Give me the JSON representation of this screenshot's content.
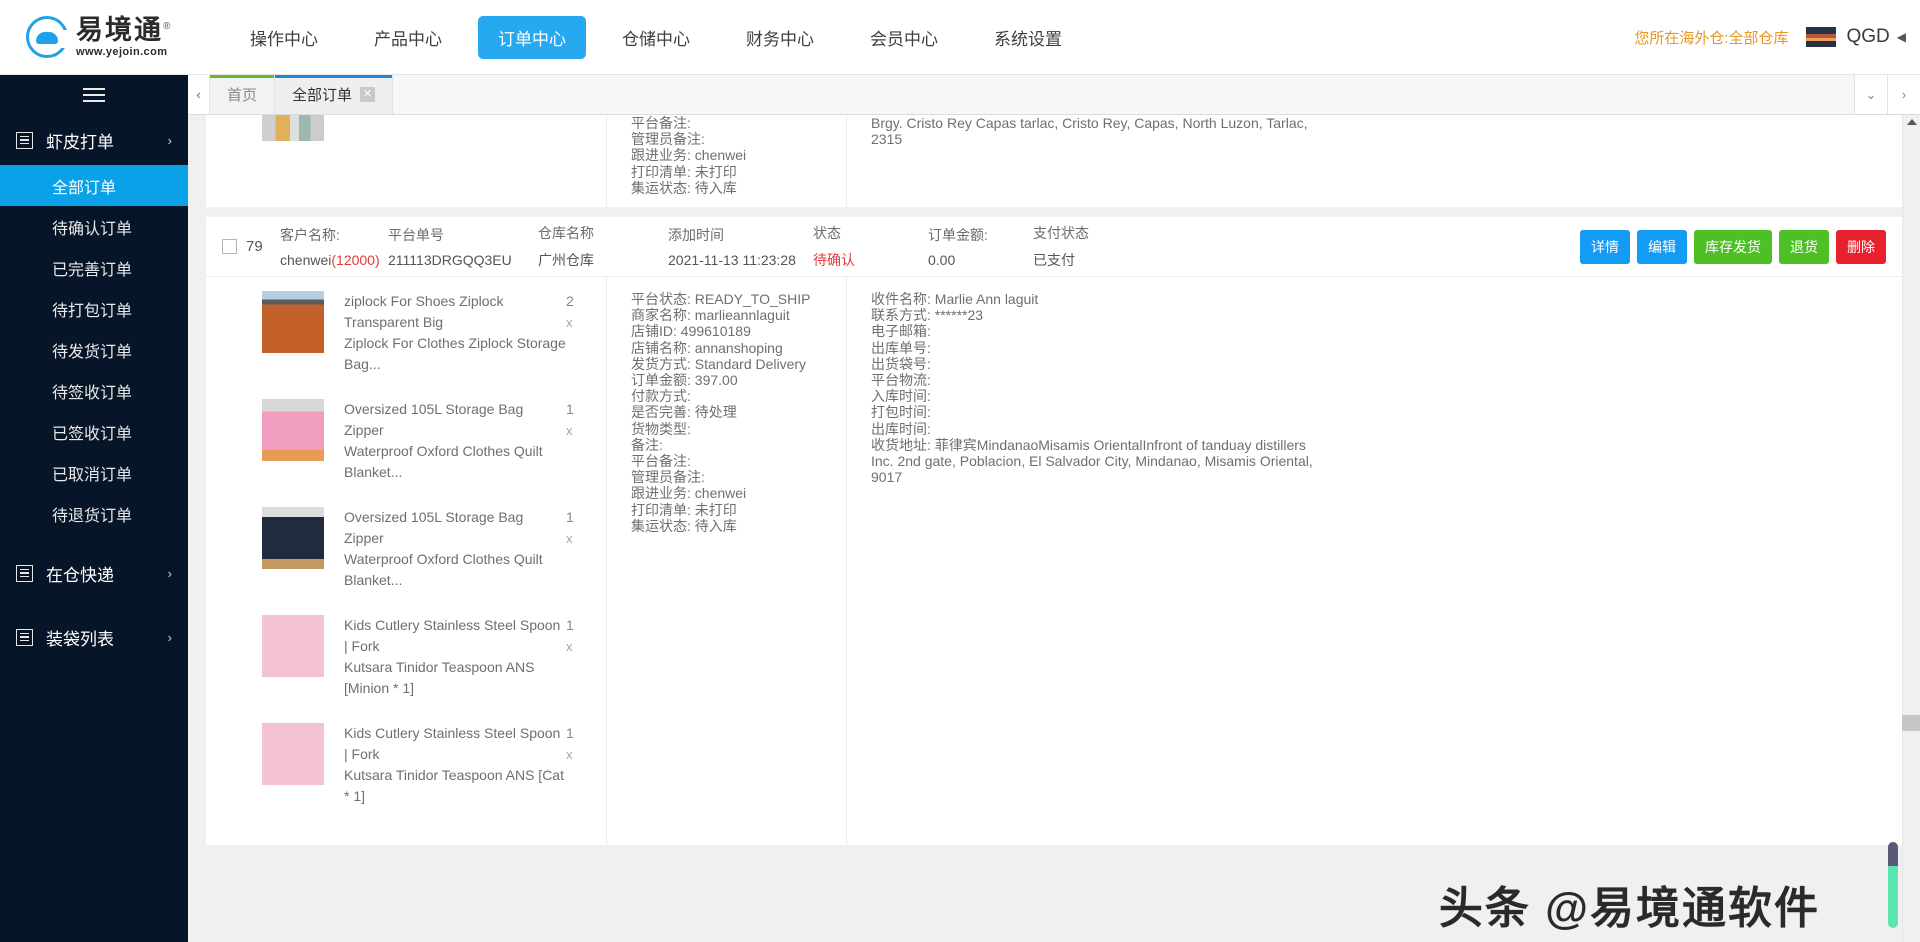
{
  "header": {
    "logo": {
      "cn": "易境通",
      "registered": "®",
      "url": "www.yejoin.com"
    },
    "nav": [
      {
        "label": "操作中心",
        "active": false
      },
      {
        "label": "产品中心",
        "active": false
      },
      {
        "label": "订单中心",
        "active": true
      },
      {
        "label": "仓储中心",
        "active": false
      },
      {
        "label": "财务中心",
        "active": false
      },
      {
        "label": "会员中心",
        "active": false
      },
      {
        "label": "系统设置",
        "active": false
      }
    ],
    "warehouse_note": "您所在海外仓:全部仓库",
    "user_name": "QGD",
    "caret": "◀",
    "accent_color": "#26a9f0",
    "note_color": "#e8961f"
  },
  "sidebar": {
    "toggle_icon": "hamburger-icon",
    "groups": [
      {
        "label": "虾皮打单",
        "arrow": "›",
        "items": [
          {
            "label": "全部订单",
            "active": true
          },
          {
            "label": "待确认订单",
            "active": false
          },
          {
            "label": "已完善订单",
            "active": false
          },
          {
            "label": "待打包订单",
            "active": false
          },
          {
            "label": "待发货订单",
            "active": false
          },
          {
            "label": "待签收订单",
            "active": false
          },
          {
            "label": "已签收订单",
            "active": false
          },
          {
            "label": "已取消订单",
            "active": false
          },
          {
            "label": "待退货订单",
            "active": false
          }
        ]
      },
      {
        "label": "在仓快递",
        "arrow": "›",
        "items": []
      },
      {
        "label": "装袋列表",
        "arrow": "›",
        "items": []
      }
    ],
    "active_color": "#0aa1e8",
    "bg_color": "#061528"
  },
  "tabstrip": {
    "prev_arrow": "‹",
    "tabs": [
      {
        "label": "首页",
        "active": false,
        "closable": false,
        "accent": "#68b92e"
      },
      {
        "label": "全部订单",
        "active": true,
        "closable": true,
        "close_icon": "close-icon",
        "close_glyph": "✕",
        "accent": "#1e86e0"
      }
    ],
    "controls": [
      {
        "icon": "chevron-down-icon",
        "glyph": "⌄"
      },
      {
        "icon": "chevron-right-icon",
        "glyph": "›"
      }
    ]
  },
  "partial_order": {
    "mid_fields": [
      {
        "key": "平台备注:",
        "value": ""
      },
      {
        "key": "管理员备注:",
        "value": ""
      },
      {
        "key": "跟进业务:",
        "value": "chenwei"
      },
      {
        "key": "打印清单:",
        "value": "未打印"
      },
      {
        "key": "集运状态:",
        "value": "待入库"
      }
    ],
    "address": "Brgy. Cristo Rey Capas tarlac, Cristo Rey, Capas, North Luzon, Tarlac, 2315"
  },
  "order": {
    "checkbox_checked": false,
    "seq": "79",
    "head_columns": [
      {
        "label": "客户名称:",
        "value": "chenwei",
        "paren": "(12000)",
        "red_paren": true
      },
      {
        "label": "平台单号",
        "value": "211113DRGQQ3EU"
      },
      {
        "label": "仓库名称",
        "value": "广州仓库"
      },
      {
        "label": "添加时间",
        "value": "2021-11-13 11:23:28"
      },
      {
        "label": "状态",
        "value": "待确认",
        "red": true
      },
      {
        "label": "订单金额:",
        "value": "0.00"
      },
      {
        "label": "支付状态",
        "value": "已支付"
      }
    ],
    "actions": [
      {
        "label": "详情",
        "color": "blue"
      },
      {
        "label": "编辑",
        "color": "blue"
      },
      {
        "label": "库存发货",
        "color": "green"
      },
      {
        "label": "退货",
        "color": "green"
      },
      {
        "label": "删除",
        "color": "red"
      }
    ],
    "products": [
      {
        "line1": "ziplock For Shoes Ziplock Transparent Big",
        "line2": "Ziplock For Clothes Ziplock Storage Bag...",
        "qty": "2",
        "x": "x",
        "thumb": "orange-jacket-thumb"
      },
      {
        "line1": "Oversized 105L Storage Bag Zipper",
        "line2": "Waterproof Oxford Clothes Quilt Blanket...",
        "qty": "1",
        "x": "x",
        "thumb": "pink-storage-bag-thumb"
      },
      {
        "line1": "Oversized 105L Storage Bag Zipper",
        "line2": "Waterproof Oxford Clothes Quilt Blanket...",
        "qty": "1",
        "x": "x",
        "thumb": "navy-storage-bag-thumb"
      },
      {
        "line1": "Kids Cutlery Stainless Steel Spoon | Fork",
        "line2": "Kutsara Tinidor Teaspoon ANS [Minion * 1]",
        "qty": "1",
        "x": "x",
        "thumb": "minion-spoon-thumb"
      },
      {
        "line1": "Kids Cutlery Stainless Steel Spoon | Fork",
        "line2": "Kutsara Tinidor Teaspoon ANS [Cat * 1]",
        "qty": "1",
        "x": "x",
        "thumb": "cat-spoon-thumb"
      }
    ],
    "mid_fields": [
      {
        "key": "平台状态:",
        "value": "READY_TO_SHIP"
      },
      {
        "key": "商家名称:",
        "value": "marlieannlaguit"
      },
      {
        "key": "店铺ID:",
        "value": "499610189"
      },
      {
        "key": "店铺名称:",
        "value": "annanshoping"
      },
      {
        "key": "发货方式:",
        "value": "Standard Delivery"
      },
      {
        "key": "订单金额:",
        "value": "397.00"
      },
      {
        "key": "付款方式:",
        "value": ""
      },
      {
        "key": "是否完善:",
        "value": "待处理"
      },
      {
        "key": "货物类型:",
        "value": ""
      },
      {
        "key": "备注:",
        "value": ""
      },
      {
        "key": "平台备注:",
        "value": ""
      },
      {
        "key": "管理员备注:",
        "value": ""
      },
      {
        "key": "跟进业务:",
        "value": "chenwei"
      },
      {
        "key": "打印清单:",
        "value": "未打印"
      },
      {
        "key": "集运状态:",
        "value": "待入库"
      }
    ],
    "right_fields": [
      {
        "key": "收件名称:",
        "value": "Marlie Ann laguit"
      },
      {
        "key": "联系方式:",
        "value": "******23"
      },
      {
        "key": "电子邮箱:",
        "value": ""
      },
      {
        "key": "出库单号:",
        "value": ""
      },
      {
        "key": "出货袋号:",
        "value": ""
      },
      {
        "key": "平台物流:",
        "value": ""
      },
      {
        "key": "入库时间:",
        "value": ""
      },
      {
        "key": "打包时间:",
        "value": ""
      },
      {
        "key": "出库时间:",
        "value": ""
      }
    ],
    "address_label": "收货地址:",
    "address": "菲律宾MindanaoMisamis OrientalInfront of tanduay distillers Inc. 2nd gate, Poblacion, El Salvador City, Mindanao, Misamis Oriental, 9017"
  },
  "watermark": "头条 @易境通软件"
}
